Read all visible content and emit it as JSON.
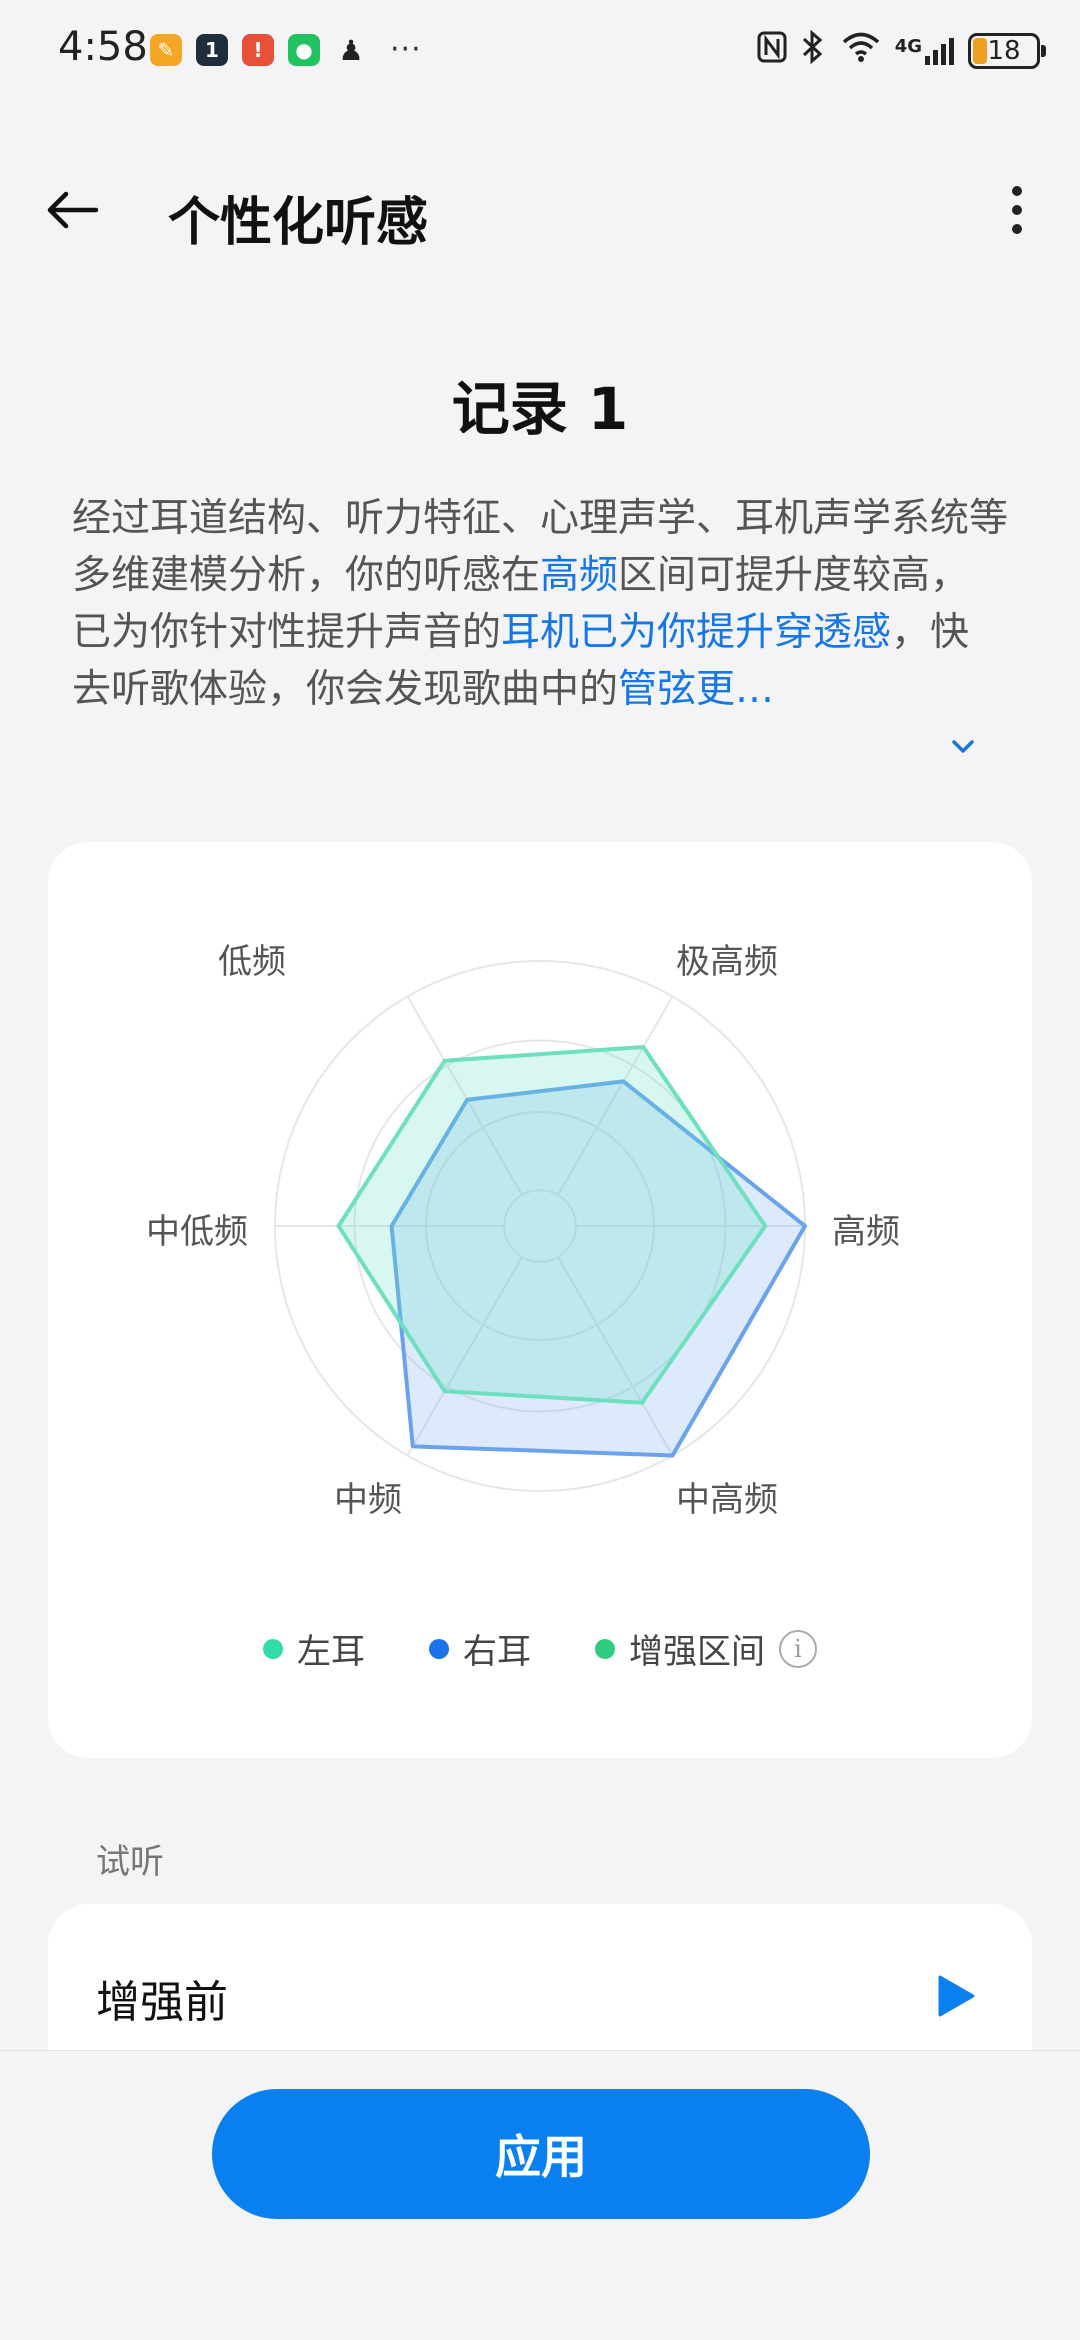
{
  "status_bar": {
    "time": "4:58",
    "battery": "18",
    "network": "4G",
    "notification_icons": [
      "orange-app-icon",
      "dark-app-icon",
      "red-app-icon",
      "wechat-icon",
      "qq-penguin-icon"
    ],
    "more": "···"
  },
  "header": {
    "title": "个性化听感"
  },
  "record": {
    "title": "记录 1",
    "desc_1": "经过耳道结构、听力特征、心理声学、耳机声学系统等多维建模分析，你的听感在",
    "desc_hl_1": "高频",
    "desc_2": "区间可提升度较高，已为你针对性提升声音的",
    "desc_hl_2": "耳机已为你提升穿透感",
    "desc_3": "，快去听歌体验，你会发现歌曲中的",
    "desc_hl_3": "管弦更…"
  },
  "chart_data": {
    "type": "radar",
    "axes": [
      "低频",
      "极高频",
      "高频",
      "中高频",
      "中频",
      "中低频"
    ],
    "max": 1.0,
    "series": [
      {
        "name": "左耳",
        "values": [
          0.72,
          0.78,
          0.85,
          0.77,
          0.72,
          0.76
        ],
        "color": "#3fdcae"
      },
      {
        "name": "右耳",
        "values": [
          0.55,
          0.63,
          1.0,
          1.0,
          0.96,
          0.56
        ],
        "color": "#1a73e8"
      }
    ]
  },
  "legend": {
    "left_ear": {
      "label": "左耳",
      "color": "#33dba8"
    },
    "right_ear": {
      "label": "右耳",
      "color": "#1a73e8"
    },
    "enhanced": {
      "label": "增强区间",
      "color": "#2ecb80"
    }
  },
  "audition": {
    "section_label": "试听",
    "before_label": "增强前"
  },
  "footer": {
    "apply_label": "应用"
  },
  "colors": {
    "accent": "#0a7ff0",
    "highlight_text": "#1676e6"
  }
}
